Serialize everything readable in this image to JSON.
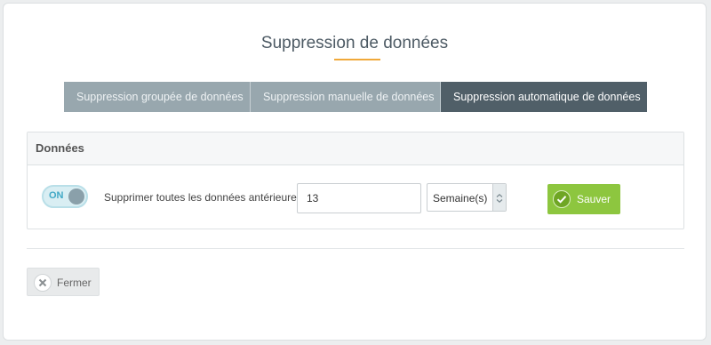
{
  "dialog": {
    "title": "Suppression de données"
  },
  "tabs": [
    {
      "label": "Suppression groupée de données",
      "active": false
    },
    {
      "label": "Suppression manuelle de données",
      "active": false
    },
    {
      "label": "Suppression automatique de données",
      "active": true
    }
  ],
  "panel": {
    "heading": "Données",
    "toggle": {
      "label": "ON",
      "state": "on"
    },
    "row_label": "Supprimer toutes les données antérieures à",
    "amount_value": "13",
    "unit_select": {
      "selected": "Semaine(s)"
    },
    "save_label": "Sauver"
  },
  "footer": {
    "close_label": "Fermer"
  },
  "colors": {
    "active_tab": "#505f68",
    "inactive_tab": "#98a7ae",
    "accent_underline": "#f0a93a",
    "save_button": "#8dc63f",
    "toggle_text": "#41a9c6"
  },
  "icons": {
    "save": "checkmark-icon",
    "close": "close-icon",
    "select": "chevron-down-icon"
  }
}
